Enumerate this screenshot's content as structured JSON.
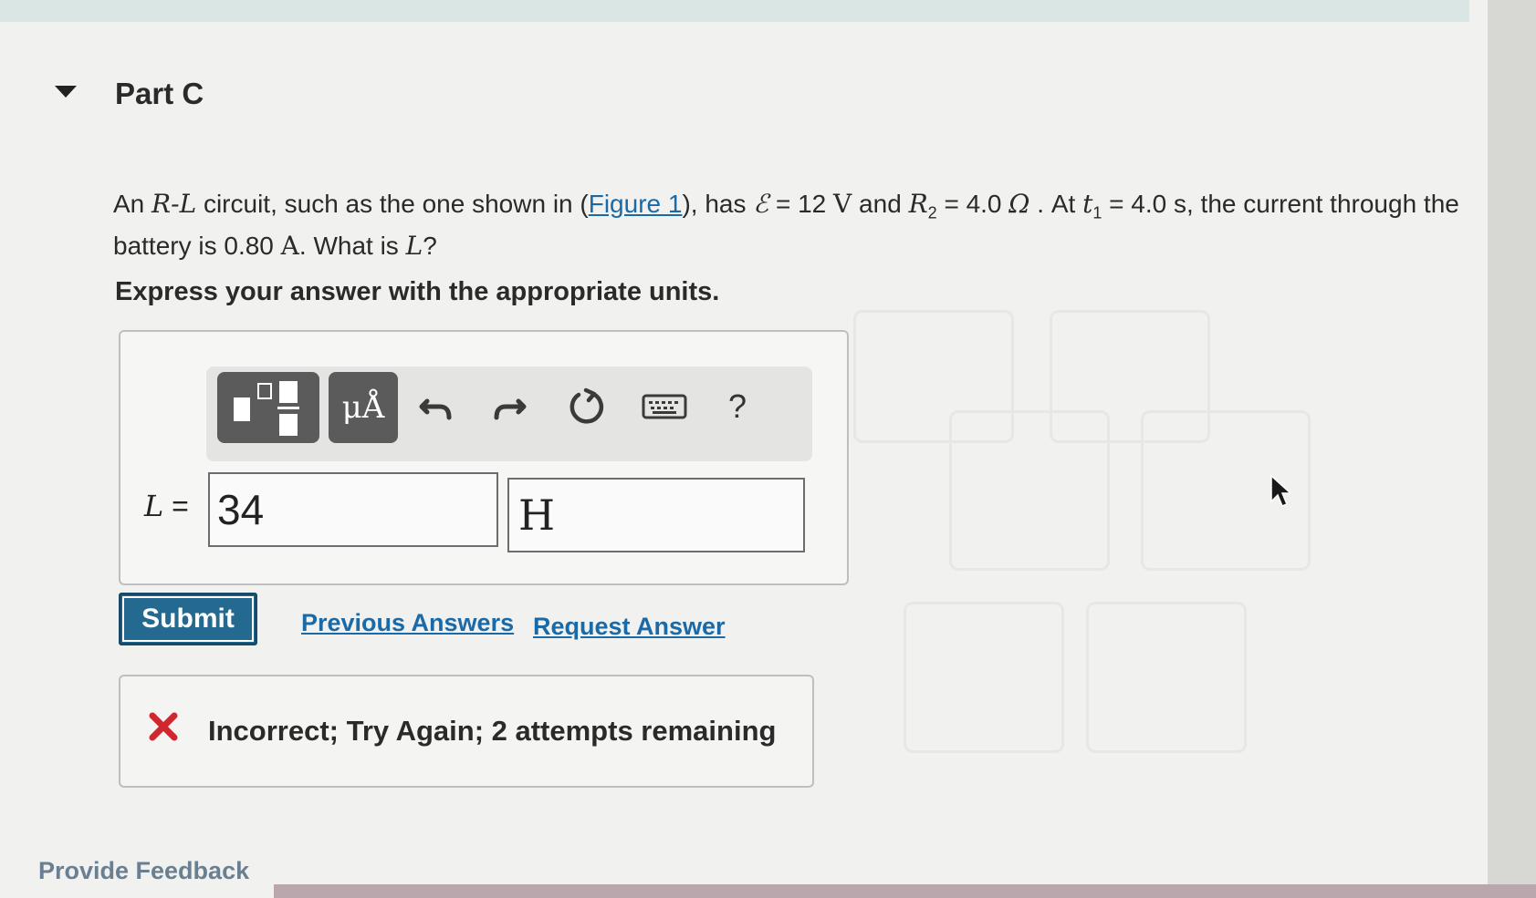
{
  "part": {
    "title": "Part C"
  },
  "problem": {
    "t1": "An ",
    "rl": "R-L",
    "t2": " circuit, such as the one shown in (",
    "figure_link": "Figure 1",
    "t3": "), has ",
    "emf": "ℰ",
    "t4": " = 12 ",
    "unit_v": "V",
    "t5": " and ",
    "r": "R",
    "r_sub": "2",
    "t6": " = 4.0 ",
    "ohm": "Ω",
    "t7": " . At ",
    "t": "t",
    "t_sub": "1",
    "t8": " = 4.0 s, the current through the battery is 0.80 ",
    "unit_a": "A",
    "t9": ". What is ",
    "l": "L",
    "t10": "?"
  },
  "instruction": "Express your answer with the appropriate units.",
  "toolbar": {
    "units_label": "μÅ",
    "help_label": "?"
  },
  "answer": {
    "variable": "L",
    "equals": "=",
    "value": "34",
    "unit": "H"
  },
  "actions": {
    "submit": "Submit",
    "previous_answers": "Previous Answers",
    "request_answer": "Request Answer"
  },
  "feedback": {
    "message": "Incorrect; Try Again; 2 attempts remaining",
    "icon_color": "#d0262d"
  },
  "footer": {
    "provide_feedback": "Provide Feedback"
  },
  "colors": {
    "link": "#1a6aa8",
    "submit_bg": "#24698f"
  }
}
